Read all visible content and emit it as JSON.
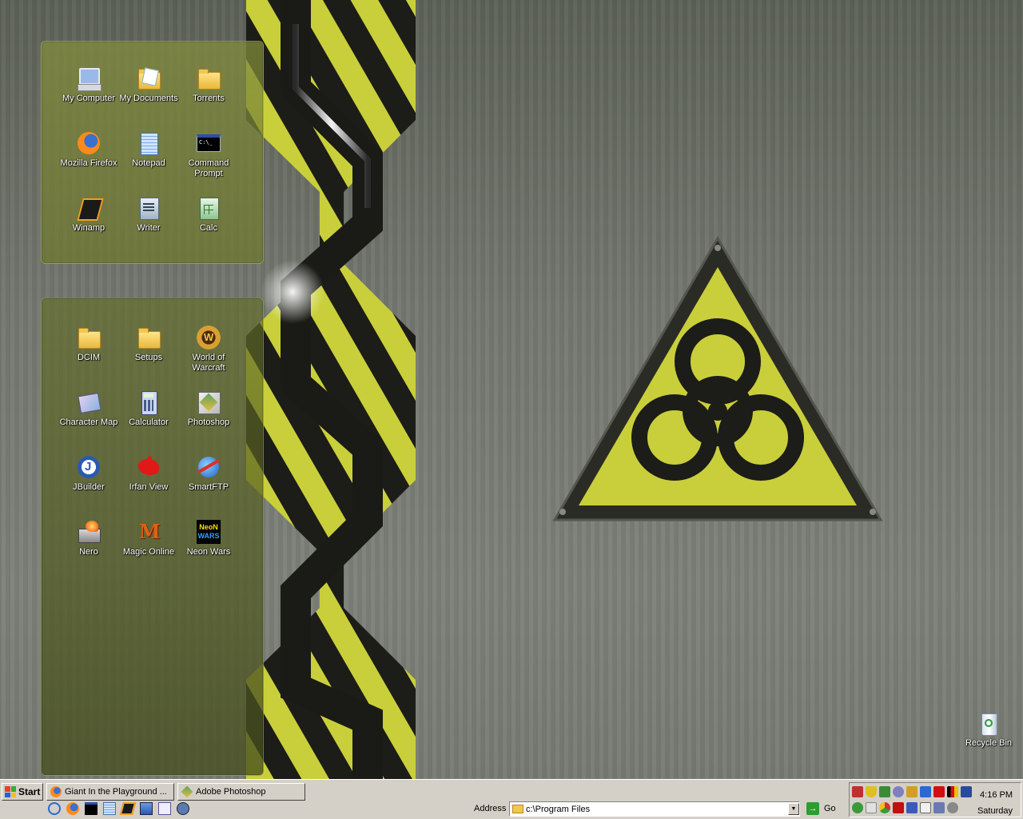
{
  "desktop": {
    "panel_top_icons": [
      {
        "label": "My Computer",
        "icon": "my-computer-icon"
      },
      {
        "label": "My Documents",
        "icon": "my-documents-icon"
      },
      {
        "label": "Torrents",
        "icon": "folder-icon"
      },
      {
        "label": "Mozilla Firefox",
        "icon": "firefox-icon"
      },
      {
        "label": "Notepad",
        "icon": "notepad-icon"
      },
      {
        "label": "Command Prompt",
        "icon": "command-prompt-icon"
      },
      {
        "label": "Winamp",
        "icon": "winamp-icon"
      },
      {
        "label": "Writer",
        "icon": "writer-icon"
      },
      {
        "label": "Calc",
        "icon": "calc-icon"
      }
    ],
    "panel_bottom_icons": [
      {
        "label": "DCIM",
        "icon": "folder-icon"
      },
      {
        "label": "Setups",
        "icon": "folder-icon"
      },
      {
        "label": "World of Warcraft",
        "icon": "warcraft-icon"
      },
      {
        "label": "Character Map",
        "icon": "character-map-icon"
      },
      {
        "label": "Calculator",
        "icon": "calculator-icon"
      },
      {
        "label": "Photoshop",
        "icon": "photoshop-icon"
      },
      {
        "label": "JBuilder",
        "icon": "jbuilder-icon"
      },
      {
        "label": "Irfan View",
        "icon": "irfanview-icon"
      },
      {
        "label": "SmartFTP",
        "icon": "smartftp-icon"
      },
      {
        "label": "Nero",
        "icon": "nero-icon"
      },
      {
        "label": "Magic Online",
        "icon": "magic-online-icon"
      },
      {
        "label": "Neon Wars",
        "icon": "neon-wars-icon"
      }
    ],
    "recycle_bin": {
      "label": "Recycle Bin",
      "icon": "recycle-bin-icon"
    }
  },
  "taskbar": {
    "start_label": "Start",
    "tasks": [
      {
        "label": "Giant In the Playground ...",
        "icon": "firefox-icon"
      },
      {
        "label": "Adobe Photoshop",
        "icon": "photoshop-icon"
      }
    ],
    "address_label": "Address",
    "address_value": "c:\\Program Files",
    "go_label": "Go",
    "clock_time": "4:16 PM",
    "clock_day": "Saturday"
  },
  "colors": {
    "hazard_yellow": "#c9cf3a",
    "hazard_black": "#1c1c18",
    "taskbar": "#d4d0c8"
  }
}
